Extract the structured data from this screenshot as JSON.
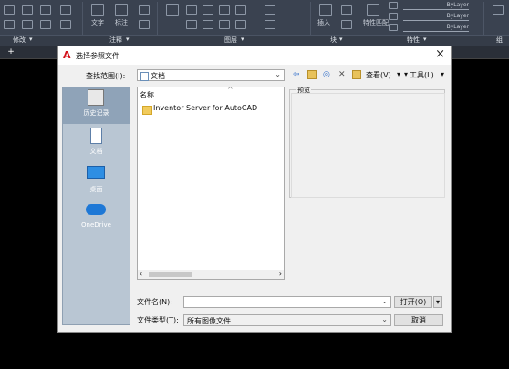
{
  "ribbon": {
    "panels": [
      "修改",
      "注释",
      "图层",
      "块",
      "特性",
      "组"
    ],
    "text_tool": "文字",
    "dim_tool": "标注",
    "insert_tool": "插入",
    "match_tool": "特性匹配",
    "bylayer": [
      "ByLayer",
      "ByLayer",
      "ByLayer"
    ]
  },
  "dialog": {
    "title": "选择参照文件",
    "lookin_label": "查找范围(I):",
    "lookin_value": "文档",
    "toolbar": {
      "views_label": "查看(V)",
      "tools_label": "工具(L)"
    },
    "places": [
      {
        "label": "历史记录",
        "icon": "history-icon"
      },
      {
        "label": "文档",
        "icon": "documents-icon"
      },
      {
        "label": "桌面",
        "icon": "desktop-icon"
      },
      {
        "label": "OneDrive",
        "icon": "onedrive-icon"
      }
    ],
    "list_header": "名称",
    "files": [
      {
        "name": "Inventor Server for AutoCAD",
        "icon": "folder-icon"
      }
    ],
    "preview_label": "预览",
    "filename_label": "文件名(N):",
    "filename_value": "",
    "filetype_label": "文件类型(T):",
    "filetype_value": "所有图像文件",
    "open_button": "打开(O)",
    "cancel_button": "取消"
  },
  "colors": {
    "accent": "#d4121b",
    "places_bg": "#b9c6d3",
    "ribbon_bg": "#3a4250"
  }
}
